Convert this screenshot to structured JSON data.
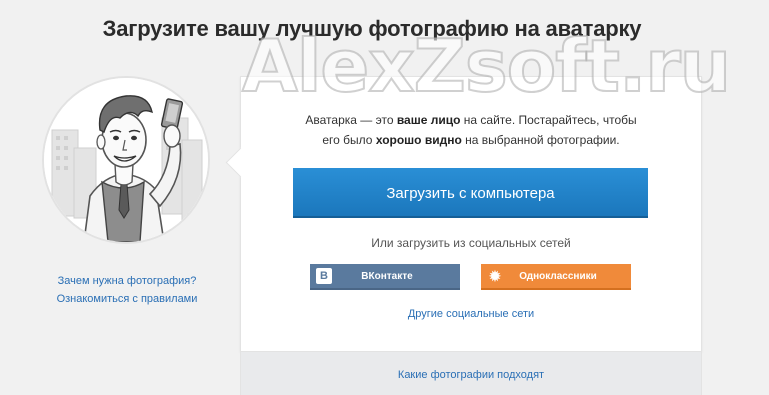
{
  "header": {
    "title": "Загрузите вашу лучшую фотографию на аватарку"
  },
  "watermark": {
    "text": "AlexZsoft.ru"
  },
  "sidebar": {
    "links": [
      {
        "label": "Зачем нужна фотография?"
      },
      {
        "label": "Ознакомиться с правилами"
      }
    ]
  },
  "card": {
    "intro": {
      "part1": "Аватарка — это ",
      "bold1": "ваше лицо",
      "part2": " на сайте. Постарайтесь, чтобы",
      "part3": "его было ",
      "bold2": "хорошо видно",
      "part4": " на выбранной фотографии."
    },
    "upload_button": "Загрузить с компьютера",
    "social_caption": "Или загрузить из социальных сетей",
    "vk_button": "ВКонтакте",
    "vk_icon": "В",
    "ok_button": "Одноклассники",
    "ok_icon": "✹",
    "other_networks": "Другие социальные сети",
    "which_photos": "Какие фотографии подходят"
  },
  "colors": {
    "upload": "#1f82c8",
    "vk": "#5a7a9e",
    "ok": "#f08a3a",
    "link": "#2a6fb5"
  }
}
